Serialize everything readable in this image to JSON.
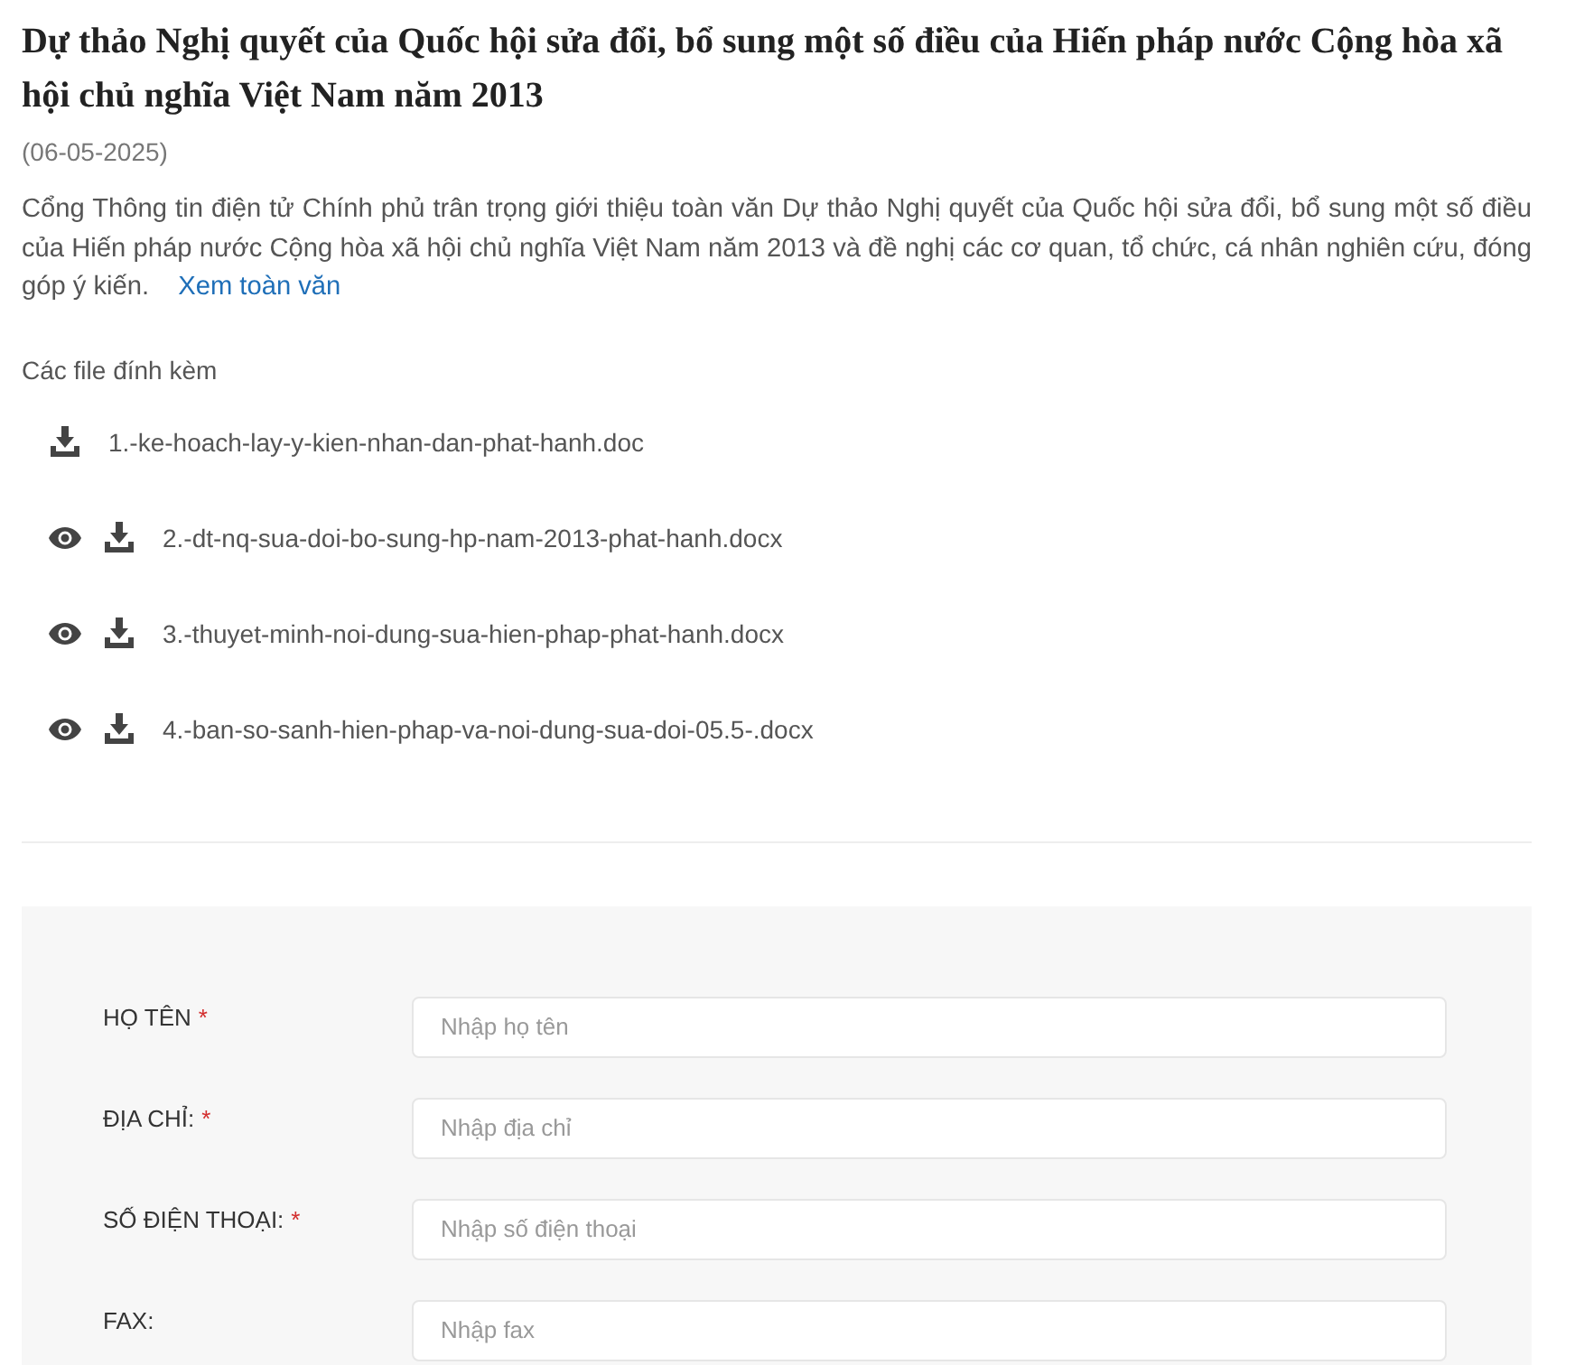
{
  "title": "Dự thảo Nghị quyết của Quốc hội sửa đổi, bổ sung một số điều của Hiến pháp nước Cộng hòa xã hội chủ nghĩa Việt Nam năm 2013",
  "date": "(06-05-2025)",
  "intro": "Cổng Thông tin điện tử Chính phủ trân trọng giới thiệu toàn văn Dự thảo Nghị quyết của Quốc hội sửa đổi, bổ sung một số điều của Hiến pháp nước Cộng hòa xã hội chủ nghĩa Việt Nam năm 2013 và đề nghị các cơ quan, tổ chức, cá nhân nghiên cứu, đóng góp ý kiến.",
  "read_more": "Xem toàn văn",
  "attachments_heading": "Các file đính kèm",
  "attachments": [
    {
      "name": "1.-ke-hoach-lay-y-kien-nhan-dan-phat-hanh.doc",
      "previewable": false
    },
    {
      "name": "2.-dt-nq-sua-doi-bo-sung-hp-nam-2013-phat-hanh.docx",
      "previewable": true
    },
    {
      "name": "3.-thuyet-minh-noi-dung-sua-hien-phap-phat-hanh.docx",
      "previewable": true
    },
    {
      "name": "4.-ban-so-sanh-hien-phap-va-noi-dung-sua-doi-05.5-.docx",
      "previewable": true
    }
  ],
  "form": {
    "fields": [
      {
        "label": "HỌ TÊN",
        "mark": "*",
        "placeholder": "Nhập họ tên"
      },
      {
        "label": "ĐỊA CHỈ:",
        "mark": "*",
        "placeholder": "Nhập địa chỉ"
      },
      {
        "label": "SỐ ĐIỆN THOẠI:",
        "mark": "*",
        "placeholder": "Nhập số điện thoại"
      },
      {
        "label": "FAX:",
        "placeholder": "Nhập fax"
      }
    ]
  }
}
